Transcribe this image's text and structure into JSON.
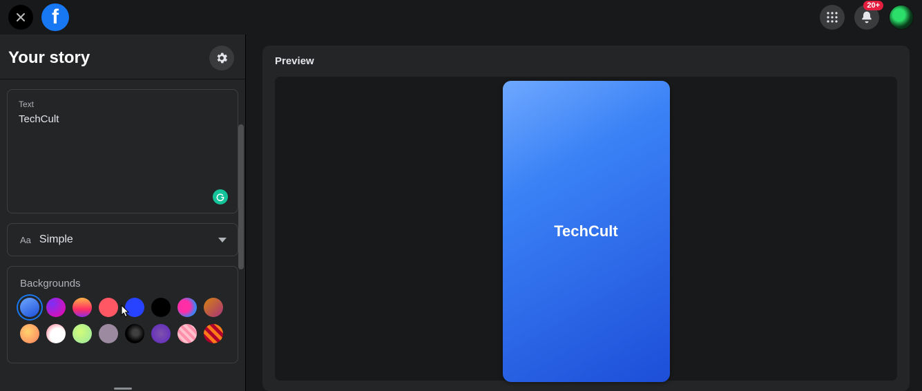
{
  "header": {
    "badge": "20+"
  },
  "sidebar": {
    "title": "Your story",
    "text_label": "Text",
    "text_value": "TechCult",
    "font_name": "Simple",
    "backgrounds_title": "Backgrounds",
    "swatches_row1": [
      {
        "name": "blue-gradient",
        "css": "linear-gradient(150deg,#6ea8ff,#1d4ed8)",
        "selected": true
      },
      {
        "name": "purple-pink",
        "css": "radial-gradient(circle at 30% 30%,#7b2ff7,#f107a3)",
        "selected": false
      },
      {
        "name": "sunset",
        "css": "linear-gradient(180deg,#ffb347,#ff2e63 60%,#8e2de2)",
        "selected": false
      },
      {
        "name": "coral",
        "css": "#ff5864",
        "selected": false
      },
      {
        "name": "royal-blue",
        "css": "#2743ff",
        "selected": false
      },
      {
        "name": "black",
        "css": "#000000",
        "selected": false
      },
      {
        "name": "magenta-blob",
        "css": "radial-gradient(circle at 35% 45%,#ff2ea6 0 35%,#3b82f6 70%)",
        "selected": false
      },
      {
        "name": "dusk",
        "css": "linear-gradient(135deg,#d38312,#a83279)",
        "selected": false
      }
    ],
    "swatches_row2": [
      {
        "name": "peach",
        "css": "radial-gradient(circle at 40% 40%,#ffd36e,#ff7e5f)",
        "selected": false
      },
      {
        "name": "white-pink",
        "css": "radial-gradient(circle at 60% 60%,#ffffff 0 45%,#ffb6c1 70%)",
        "selected": false
      },
      {
        "name": "lime",
        "css": "radial-gradient(circle at 40% 40%,#d4fc79,#96e6a1)",
        "selected": false
      },
      {
        "name": "mauve",
        "css": "#9b8aa0",
        "selected": false
      },
      {
        "name": "black-marble",
        "css": "radial-gradient(circle at 55% 45%,#404040 0 20%,#000 60%)",
        "selected": false
      },
      {
        "name": "violet",
        "css": "radial-gradient(circle at 50% 50%,#7f53ac,#5d26c1)",
        "selected": false
      },
      {
        "name": "pink-stripe",
        "css": "repeating-linear-gradient(45deg,#ffc0cb 0 4px,#ff8fab 4px 8px)",
        "selected": false
      },
      {
        "name": "orange-check",
        "css": "repeating-linear-gradient(45deg,#ff7a18 0 5px,#af002d 5px 10px)",
        "selected": false
      }
    ]
  },
  "preview": {
    "label": "Preview",
    "story_text": "TechCult"
  }
}
